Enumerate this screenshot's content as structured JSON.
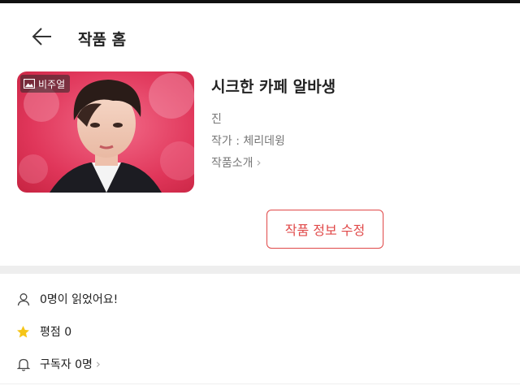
{
  "header": {
    "title": "작품 홈",
    "back_icon": "back-arrow-icon"
  },
  "work": {
    "badge_label": "비주얼",
    "badge_icon": "image-icon",
    "title": "시크한 카페 알바생",
    "character": "진",
    "author": "작가 : 체리데윙",
    "intro_label": "작품소개",
    "edit_button": "작품 정보 수정"
  },
  "stats": {
    "readers": "0명이 읽었어요!",
    "rating": "평점 0",
    "subscribers": "구독자 0명"
  },
  "colors": {
    "accent": "#e04848",
    "star": "#f5c518"
  }
}
